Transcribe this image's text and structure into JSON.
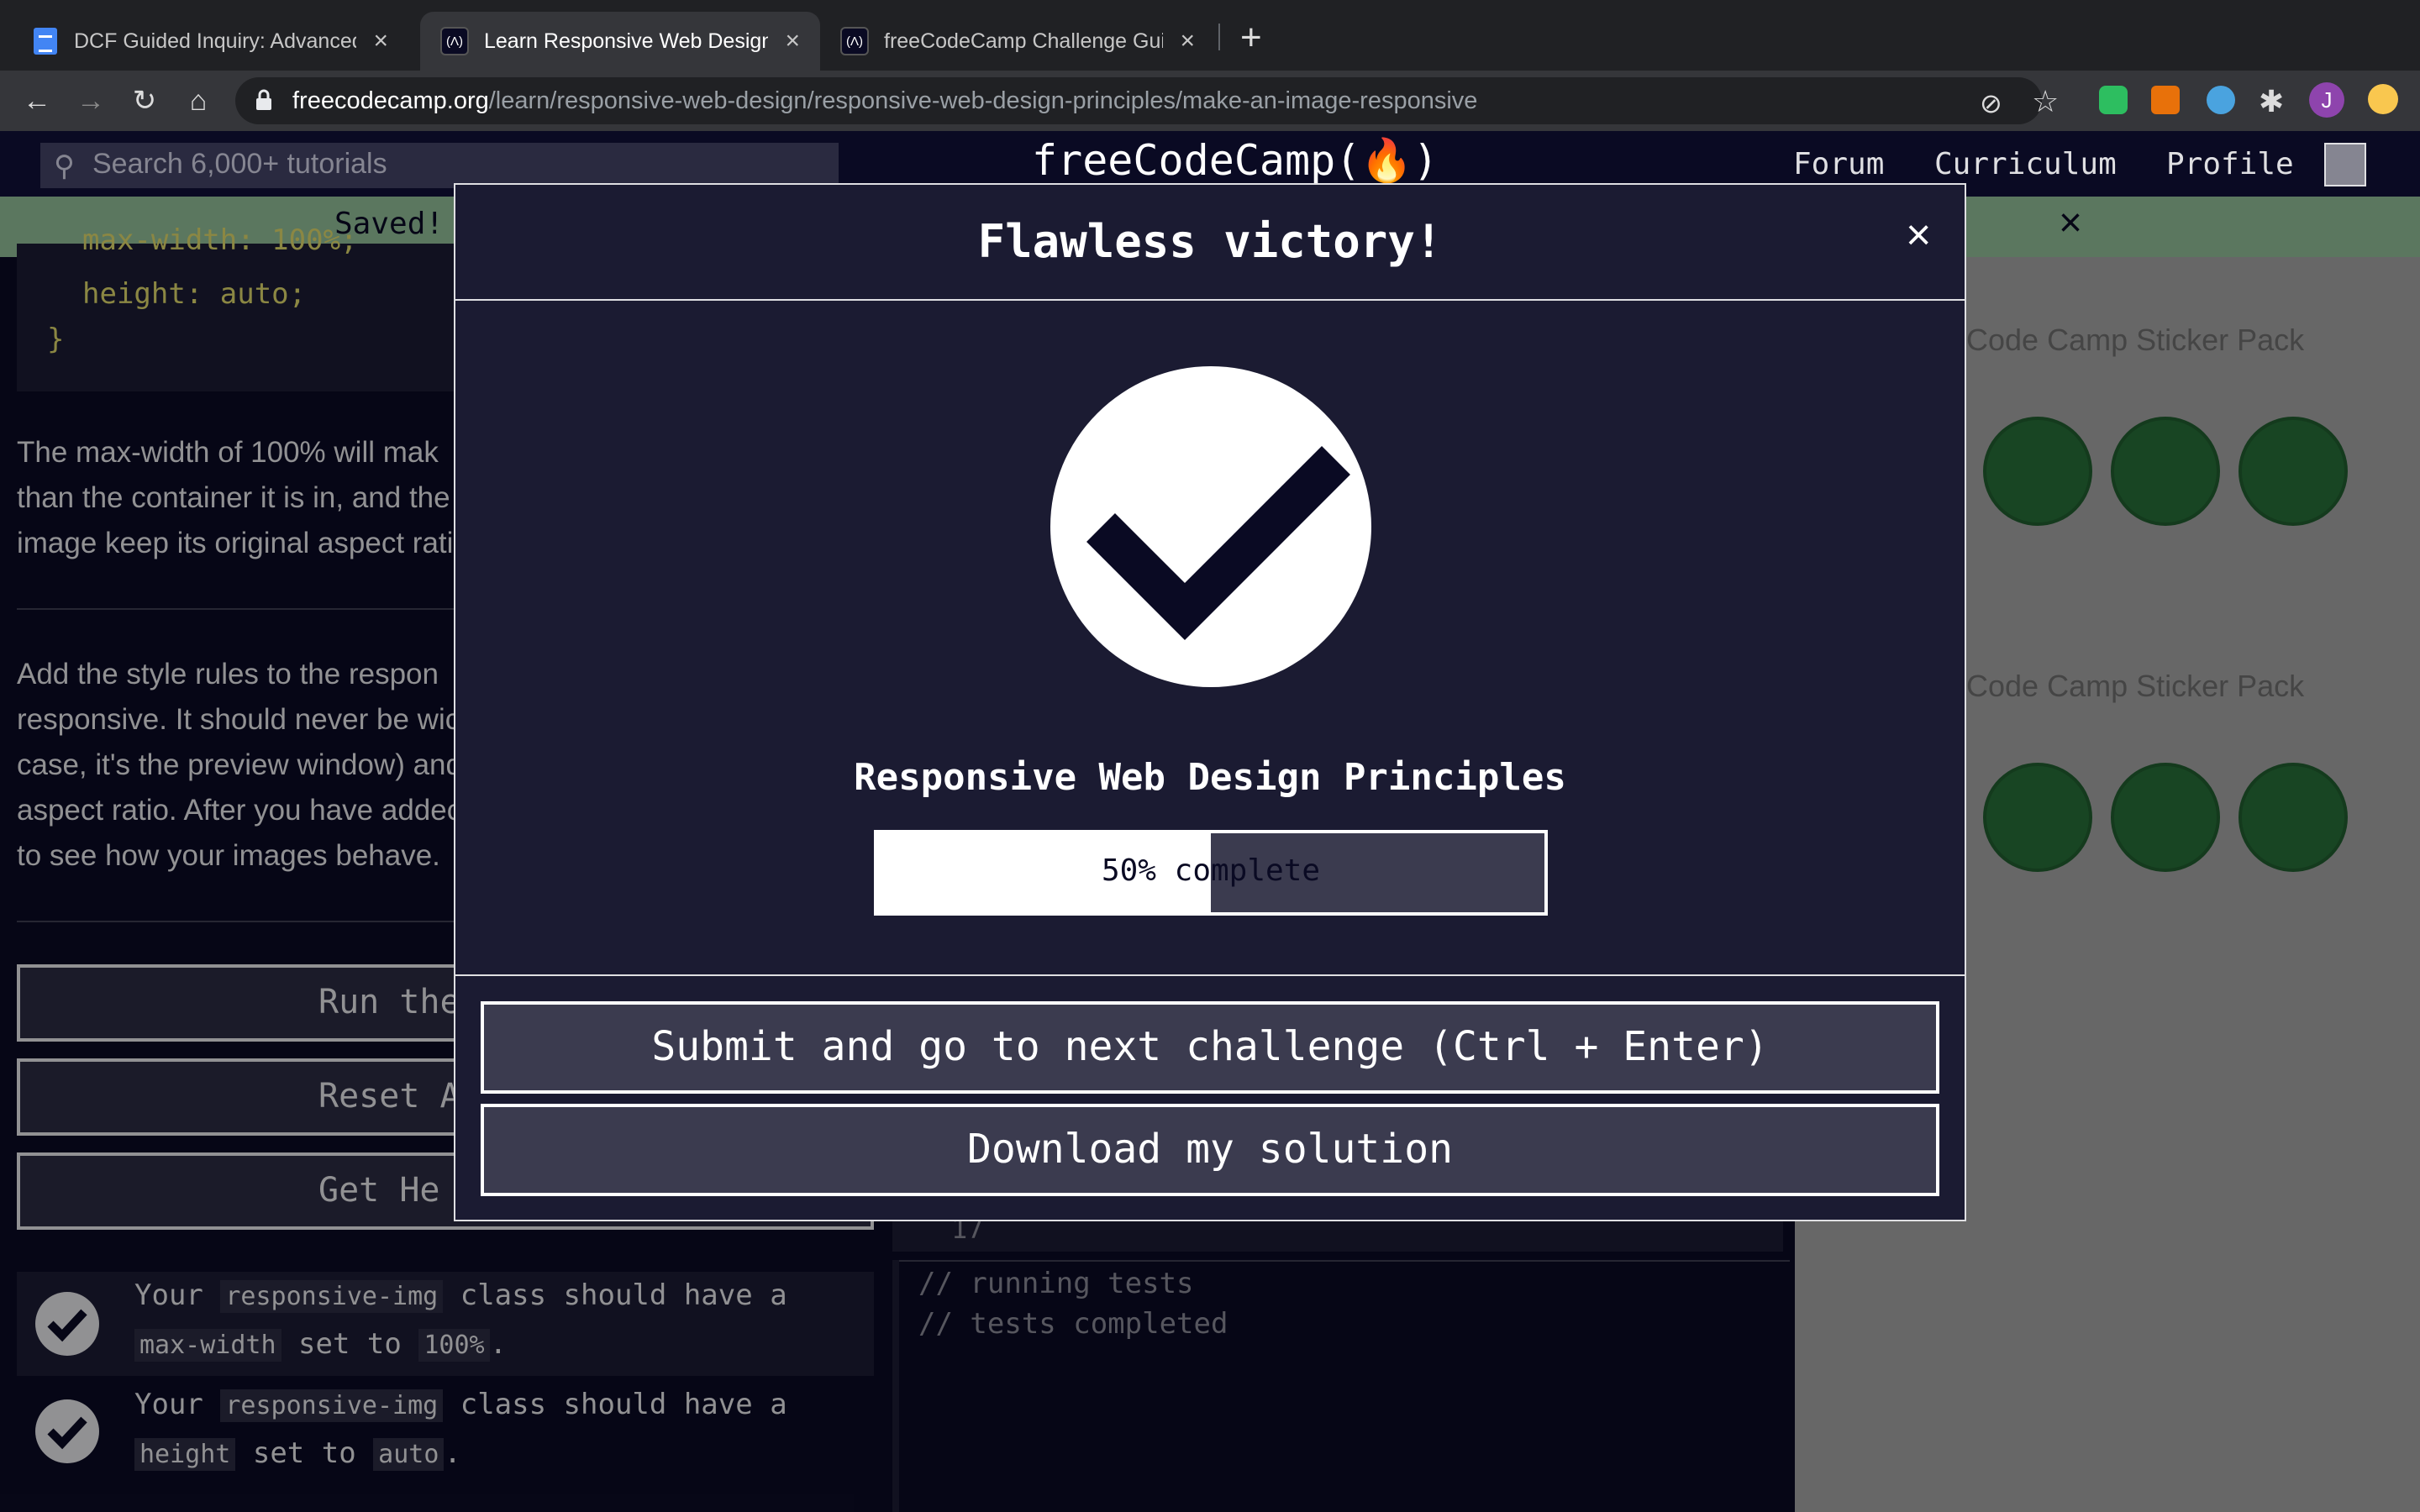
{
  "browser": {
    "tabs": [
      {
        "title": "DCF Guided Inquiry: Advanced",
        "favicon": "google-docs-icon"
      },
      {
        "title": "Learn Responsive Web Design",
        "favicon": "freecodecamp-icon"
      },
      {
        "title": "freeCodeCamp Challenge Guid",
        "favicon": "freecodecamp-icon"
      }
    ],
    "new_tab": "+",
    "tab_close": "×",
    "url_host": "freecodecamp.org",
    "url_path": "/learn/responsive-web-design/responsive-web-design-principles/make-an-image-responsive",
    "profile_initial": "J"
  },
  "fcc_nav": {
    "search_placeholder": "Search 6,000+ tutorials",
    "logo": "freeCodeCamp(🔥)",
    "links": [
      "Forum",
      "Curriculum",
      "Profile"
    ]
  },
  "saved_bar": {
    "text": "Saved!",
    "close": "×"
  },
  "lesson": {
    "code_lines": [
      "max-width: 100%;",
      "height: auto;",
      "}"
    ],
    "para1": [
      "The max-width of 100% will mak",
      "than the container it is in, and the",
      "image keep its original aspect rati"
    ],
    "para2": [
      "Add the style rules to the respon",
      "responsive. It should never be wic",
      "case, it's the preview window) and",
      "aspect ratio. After you have addec",
      "to see how your images behave."
    ],
    "buttons": [
      "Run the",
      "Reset Al",
      "Get He"
    ],
    "tests": [
      {
        "prefix": "Your",
        "code1": "responsive-img",
        "mid": "class should have a",
        "code2": "max-width",
        "mid2": "set to",
        "code3": "100%",
        "end": "."
      },
      {
        "prefix": "Your",
        "code1": "responsive-img",
        "mid": "class should have a",
        "code2": "height",
        "mid2": "set to",
        "code3": "auto",
        "end": "."
      }
    ]
  },
  "editor": {
    "line_number": "17"
  },
  "console": {
    "lines": [
      "// running tests",
      "// tests completed"
    ]
  },
  "preview": {
    "titles": [
      "Code Camp Sticker Pack",
      "Code Camp Sticker Pack"
    ]
  },
  "modal": {
    "title": "Flawless victory!",
    "close": "×",
    "block_title": "Responsive Web Design Principles",
    "progress_percent": 50,
    "progress_label": "50% complete",
    "submit_button": "Submit and go to next challenge (Ctrl + Enter)",
    "download_button": "Download my solution"
  },
  "colors": {
    "bg": "#0a0a23",
    "panel": "#1b1b32",
    "accent": "#3b3b4f",
    "saved": "#a5d6a7"
  }
}
